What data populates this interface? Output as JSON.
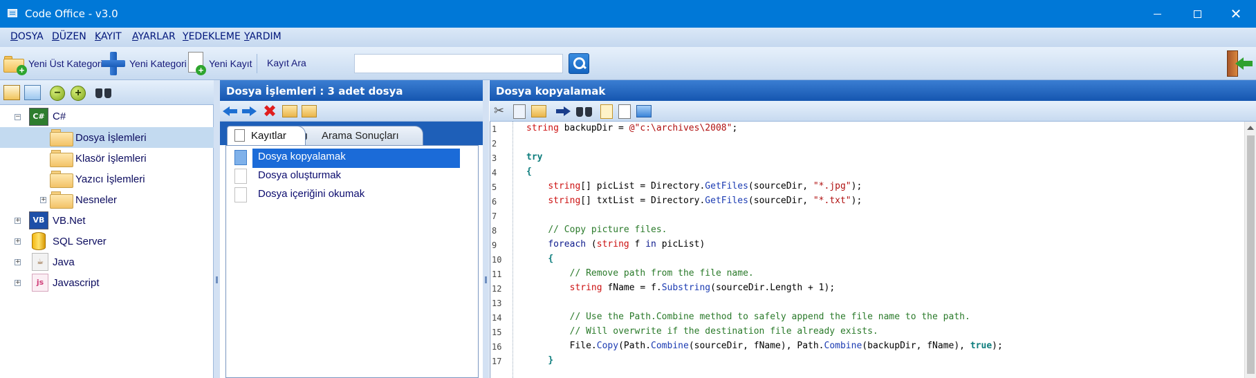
{
  "window": {
    "title": "Code Office - v3.0"
  },
  "menu": [
    "DOSYA",
    "DÜZEN",
    "KAYIT",
    "AYARLAR",
    "YEDEKLEME",
    "YARDIM"
  ],
  "toolbar": {
    "new_parent_category": "Yeni Üst Kategori",
    "new_category": "Yeni Kategori",
    "new_record": "Yeni Kayıt",
    "search_label": "Kayıt Ara",
    "search_value": ""
  },
  "tree": [
    {
      "label": "C#",
      "icon": "csharp-icon",
      "expanded": true
    },
    {
      "label": "Dosya İşlemleri",
      "icon": "folder-icon",
      "selected": true
    },
    {
      "label": "Klasör İşlemleri",
      "icon": "folder-icon"
    },
    {
      "label": "Yazıcı İşlemleri",
      "icon": "folder-icon"
    },
    {
      "label": "Nesneler",
      "icon": "folder-icon"
    },
    {
      "label": "VB.Net",
      "icon": "vbnet-icon"
    },
    {
      "label": "SQL Server",
      "icon": "database-icon"
    },
    {
      "label": "Java",
      "icon": "java-icon"
    },
    {
      "label": "Javascript",
      "icon": "javascript-icon"
    }
  ],
  "middle": {
    "header": "Dosya İşlemleri : 3 adet dosya",
    "tabs": [
      "Kayıtlar",
      "Arama Sonuçları"
    ],
    "records": [
      "Dosya kopyalamak",
      "Dosya oluşturmak",
      "Dosya içeriğini okumak"
    ]
  },
  "right": {
    "header": "Dosya kopyalamak",
    "line_numbers": [
      "1",
      "2",
      "3",
      "4",
      "5",
      "6",
      "7",
      "8",
      "9",
      "10",
      "11",
      "12",
      "13",
      "14",
      "15",
      "16",
      "17"
    ]
  },
  "colors": {
    "title_bar": "#0078d7",
    "panel_header": "#1556b0",
    "selection": "#1b6bd8"
  }
}
